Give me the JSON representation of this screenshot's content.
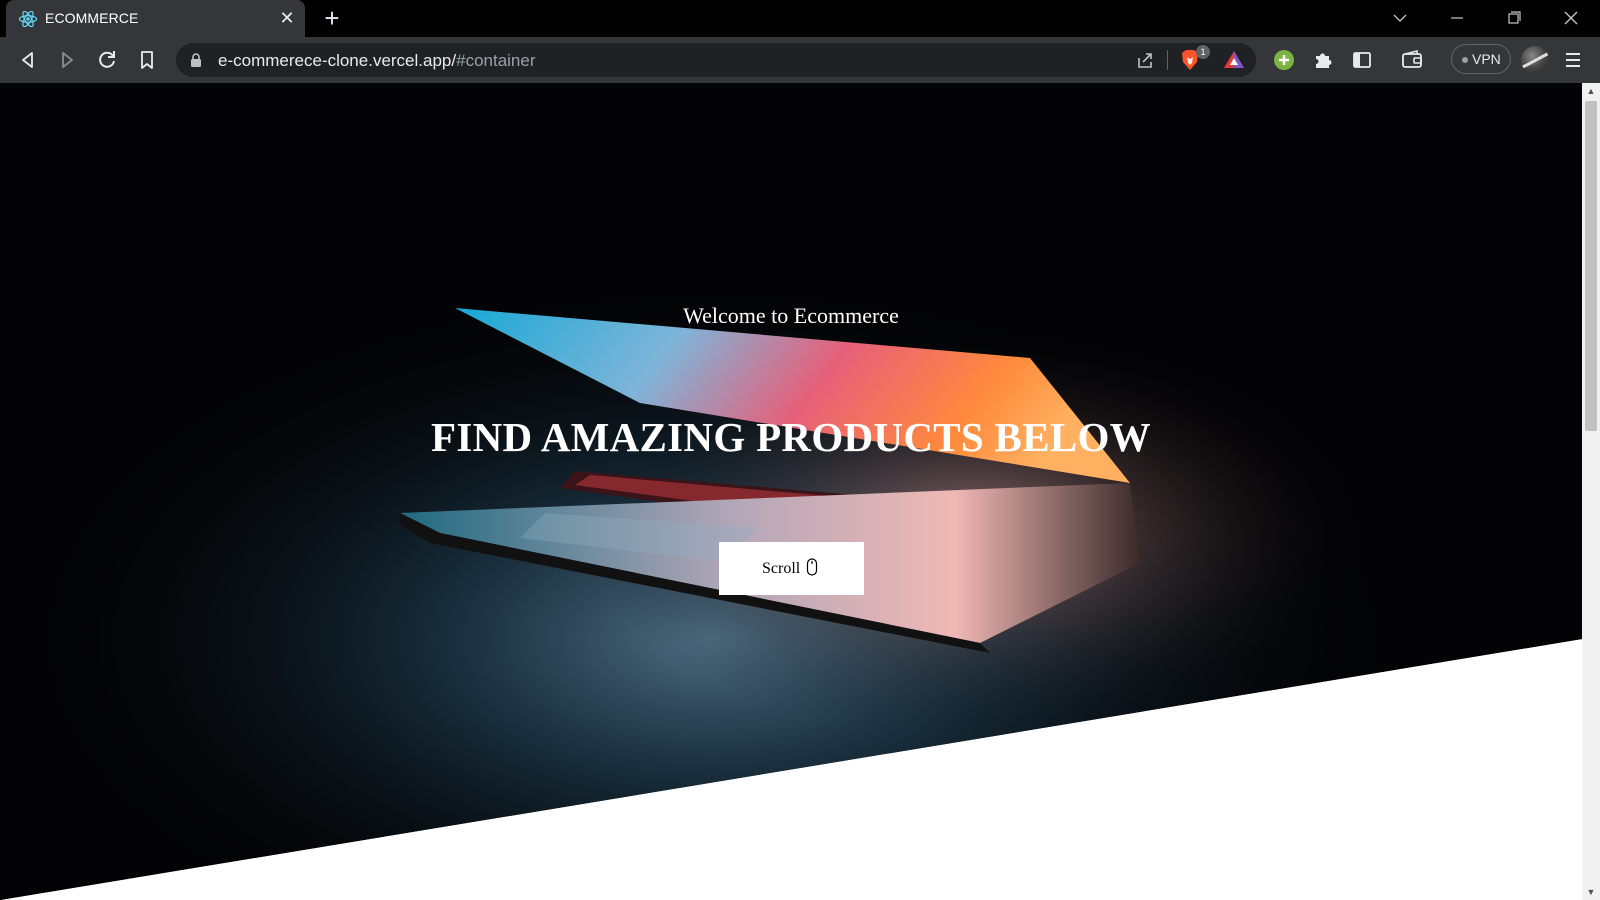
{
  "browser": {
    "tab": {
      "title": "ECOMMERCE",
      "favicon": "react-icon"
    },
    "new_tab": "+",
    "window_controls": [
      "tab-search-icon",
      "minimize-icon",
      "restore-icon",
      "close-icon"
    ],
    "address": {
      "host": "e-commerece-clone.vercel.app/",
      "path": "#container"
    },
    "brave_shields_count": "1",
    "vpn_label": "VPN",
    "accent_colors": {
      "extension_green": "#7cb342",
      "rewards_red": "#e53935",
      "brave_orange": "#fb542b"
    }
  },
  "page": {
    "welcome": "Welcome to Ecommerce",
    "headline": "FIND AMAZING PRODUCTS BELOW",
    "scroll_button": {
      "label": "Scroll",
      "icon": "mouse-icon"
    },
    "background_image": "laptop-photo"
  }
}
